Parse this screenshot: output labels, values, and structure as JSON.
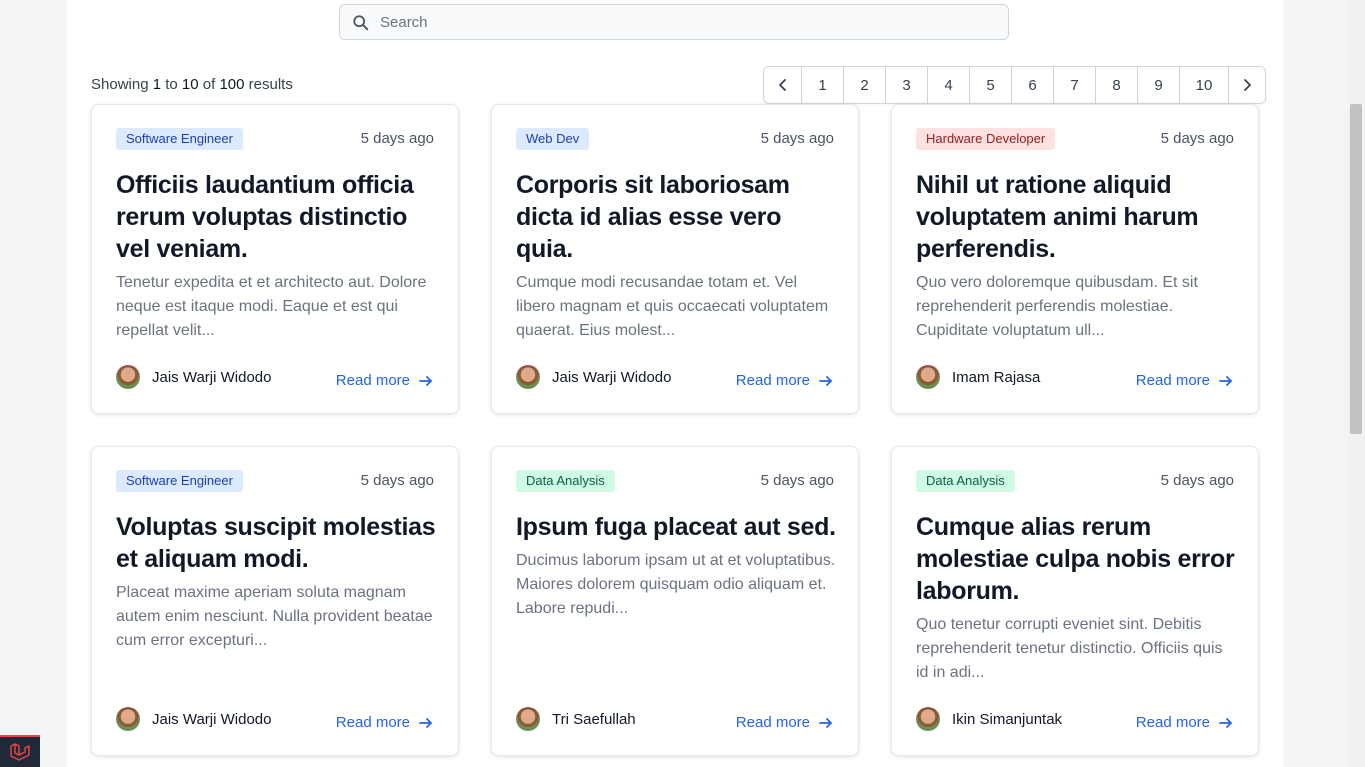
{
  "search": {
    "placeholder": "Search",
    "value": ""
  },
  "results": {
    "prefix": "Showing",
    "from": "1",
    "to_word": "to",
    "to": "10",
    "of_word": "of",
    "total": "100",
    "suffix": "results"
  },
  "pagination": {
    "pages": [
      "1",
      "2",
      "3",
      "4",
      "5",
      "6",
      "7",
      "8",
      "9",
      "10"
    ]
  },
  "colors": {
    "accent": "#2563eb",
    "badge_blue": "#dbeafe",
    "badge_red": "#fee2e2",
    "badge_green": "#d1fae5"
  },
  "cards": [
    {
      "category": "Software Engineer",
      "category_color": "blue",
      "time": "5 days ago",
      "title": "Officiis laudantium officia rerum voluptas distinctio vel veniam.",
      "excerpt": "Tenetur expedita et et architecto aut. Dolore neque est itaque modi. Eaque et est qui repellat velit...",
      "author": "Jais Warji Widodo",
      "read_more": "Read more"
    },
    {
      "category": "Web Dev",
      "category_color": "blue",
      "time": "5 days ago",
      "title": "Corporis sit laboriosam dicta id alias esse vero quia.",
      "excerpt": "Cumque modi recusandae totam et. Vel libero magnam et quis occaecati voluptatem quaerat. Eius molest...",
      "author": "Jais Warji Widodo",
      "read_more": "Read more"
    },
    {
      "category": "Hardware Developer",
      "category_color": "red",
      "time": "5 days ago",
      "title": "Nihil ut ratione aliquid voluptatem animi harum perferendis.",
      "excerpt": "Quo vero doloremque quibusdam. Et sit reprehenderit perferendis molestiae. Cupiditate voluptatum ull...",
      "author": "Imam Rajasa",
      "read_more": "Read more"
    },
    {
      "category": "Software Engineer",
      "category_color": "blue",
      "time": "5 days ago",
      "title": "Voluptas suscipit molestias et aliquam modi.",
      "excerpt": "Placeat maxime aperiam soluta magnam autem enim nesciunt. Nulla provident beatae cum error excepturi...",
      "author": "Jais Warji Widodo",
      "read_more": "Read more"
    },
    {
      "category": "Data Analysis",
      "category_color": "green",
      "time": "5 days ago",
      "title": "Ipsum fuga placeat aut sed.",
      "excerpt": "Ducimus laborum ipsam ut at et voluptatibus. Maiores dolorem quisquam odio aliquam et. Labore repudi...",
      "author": "Tri Saefullah",
      "read_more": "Read more"
    },
    {
      "category": "Data Analysis",
      "category_color": "green",
      "time": "5 days ago",
      "title": "Cumque alias rerum molestiae culpa nobis error laborum.",
      "excerpt": "Quo tenetur corrupti eveniet sint. Debitis reprehenderit tenetur distinctio. Officiis quis id in adi...",
      "author": "Ikin Simanjuntak",
      "read_more": "Read more"
    }
  ]
}
